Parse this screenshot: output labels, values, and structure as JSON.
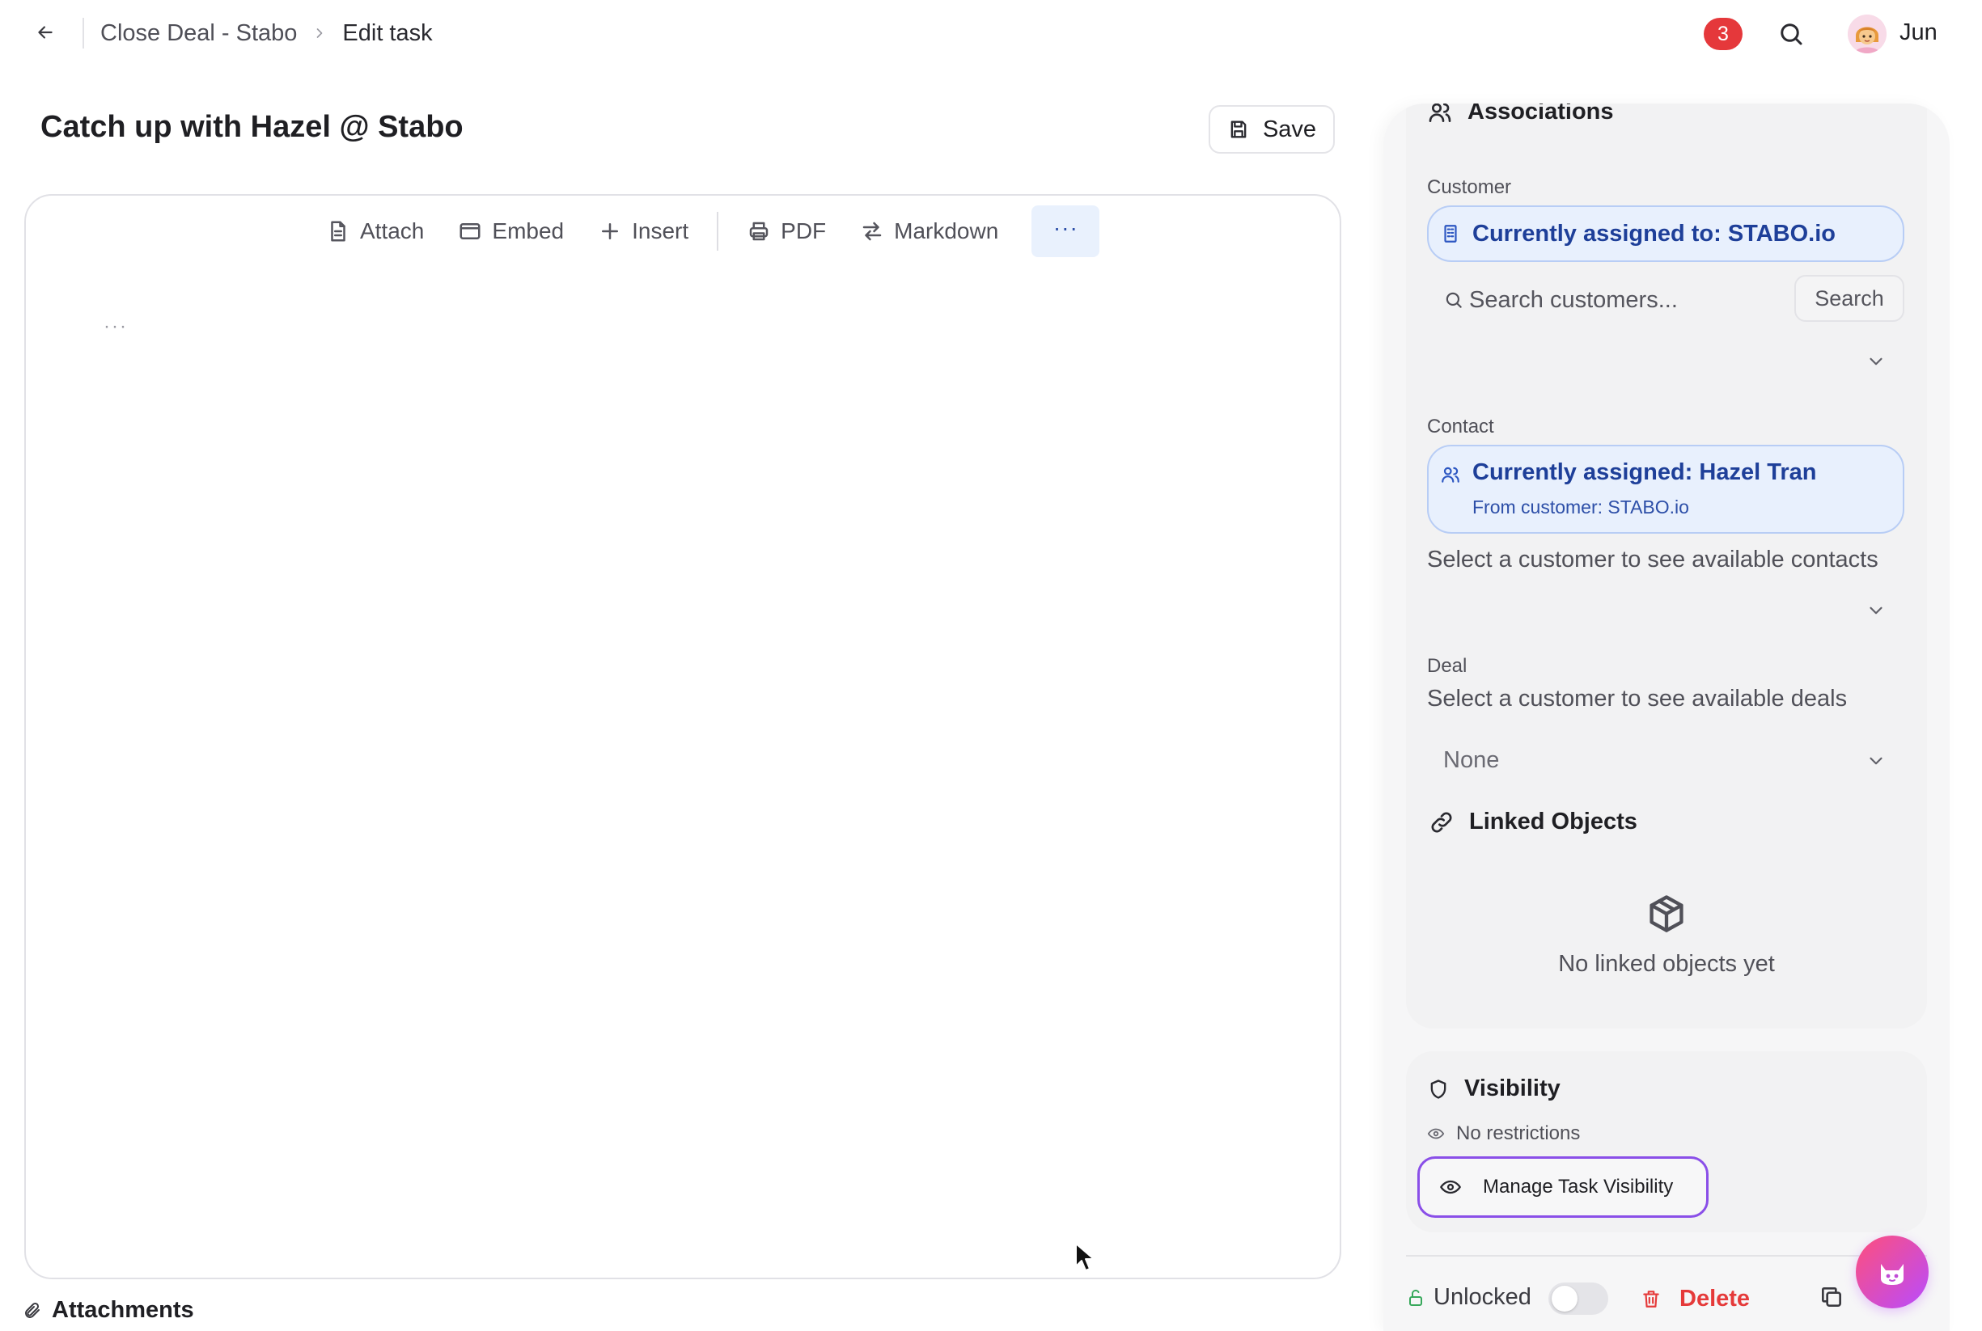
{
  "topbar": {
    "breadcrumb_parent": "Close Deal - Stabo",
    "breadcrumb_current": "Edit task",
    "notification_count": "3",
    "user_name": "Jun"
  },
  "task": {
    "title": "Catch up with Hazel @ Stabo",
    "save_label": "Save"
  },
  "editor": {
    "toolbar": {
      "attach": "Attach",
      "embed": "Embed",
      "insert": "Insert",
      "pdf": "PDF",
      "markdown": "Markdown",
      "more": "···"
    },
    "placeholder": "···"
  },
  "attachments_label": "Attachments",
  "associations": {
    "title": "Associations",
    "customer": {
      "label": "Customer",
      "assigned": "Currently assigned to: STABO.io",
      "search_placeholder": "Search customers...",
      "search_button": "Search"
    },
    "contact": {
      "label": "Contact",
      "assigned": "Currently assigned: Hazel Tran",
      "from_customer": "From customer: STABO.io",
      "help": "Select a customer to see available contacts"
    },
    "deal": {
      "label": "Deal",
      "help": "Select a customer to see available deals",
      "selected": "None"
    }
  },
  "linked_objects": {
    "title": "Linked Objects",
    "empty": "No linked objects yet"
  },
  "visibility": {
    "title": "Visibility",
    "status": "No restrictions",
    "manage_button": "Manage Task Visibility"
  },
  "footer": {
    "lock_status": "Unlocked",
    "delete_label": "Delete"
  },
  "colors": {
    "accent_blue": "#1e3f99",
    "delete_red": "#e53a3a",
    "badge_red": "#e5383b",
    "focus_purple": "#8a4fe8",
    "unlock_green": "#37a85b"
  }
}
